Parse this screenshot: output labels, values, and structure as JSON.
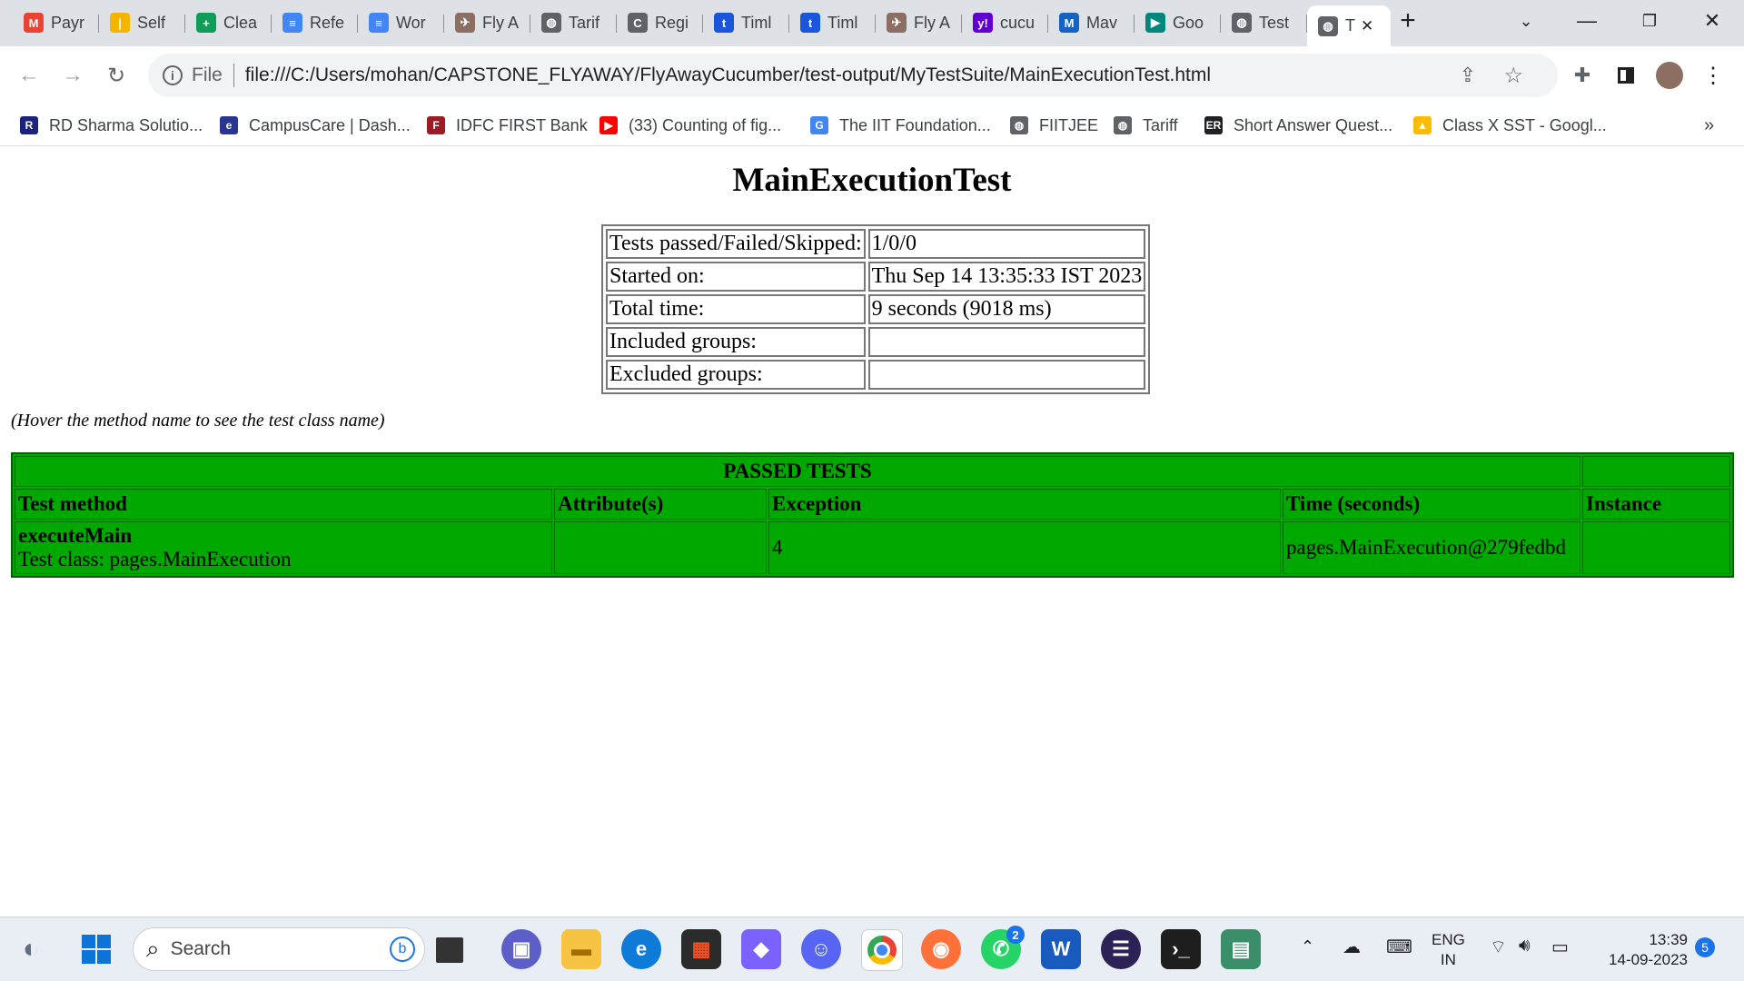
{
  "tabs": [
    {
      "label": "Payr",
      "icon": "gmail-icon",
      "color": "#ea4335",
      "glyph": "M"
    },
    {
      "label": "Self",
      "icon": "analytics-icon",
      "color": "#f4b400",
      "glyph": "|"
    },
    {
      "label": "Clea",
      "icon": "sheets-icon",
      "color": "#0f9d58",
      "glyph": "+"
    },
    {
      "label": "Refe",
      "icon": "docs-icon",
      "color": "#4285f4",
      "glyph": "≡"
    },
    {
      "label": "Wor",
      "icon": "docs-icon",
      "color": "#4285f4",
      "glyph": "≡"
    },
    {
      "label": "Fly A",
      "icon": "image-icon",
      "color": "#8d6e63",
      "glyph": "✈"
    },
    {
      "label": "Tarif",
      "icon": "globe-icon",
      "color": "#5f6368",
      "glyph": "◍"
    },
    {
      "label": "Regi",
      "icon": "c-icon",
      "color": "#5f6368",
      "glyph": "C"
    },
    {
      "label": "Timl",
      "icon": "t-icon",
      "color": "#1a56db",
      "glyph": "t"
    },
    {
      "label": "Timl",
      "icon": "t-icon",
      "color": "#1a56db",
      "glyph": "t"
    },
    {
      "label": "Fly A",
      "icon": "image-icon",
      "color": "#8d6e63",
      "glyph": "✈"
    },
    {
      "label": "cucu",
      "icon": "yahoo-icon",
      "color": "#6001d2",
      "glyph": "y!"
    },
    {
      "label": "Mav",
      "icon": "mvn-icon",
      "color": "#1565c0",
      "glyph": "M"
    },
    {
      "label": "Goo",
      "icon": "meet-icon",
      "color": "#00897b",
      "glyph": "▶"
    },
    {
      "label": "Test",
      "icon": "globe-icon",
      "color": "#5f6368",
      "glyph": "◍"
    },
    {
      "label": "T",
      "icon": "globe-icon",
      "color": "#5f6368",
      "glyph": "◍",
      "active": true
    }
  ],
  "address": {
    "scheme_label": "File",
    "url": "file:///C:/Users/mohan/CAPSTONE_FLYAWAY/FlyAwayCucumber/test-output/MyTestSuite/MainExecutionTest.html"
  },
  "bookmarks": [
    {
      "label": "RD Sharma Solutio...",
      "icon": "rd-sharma-icon",
      "color": "#1a237e",
      "glyph": "R"
    },
    {
      "label": "CampusCare | Dash...",
      "icon": "campuscare-icon",
      "color": "#283593",
      "glyph": "e"
    },
    {
      "label": "IDFC FIRST Bank",
      "icon": "idfc-icon",
      "color": "#9c1c24",
      "glyph": "F"
    },
    {
      "label": "(33) Counting of fig...",
      "icon": "youtube-icon",
      "color": "#ff0000",
      "glyph": "▶"
    },
    {
      "label": "The IIT Foundation...",
      "icon": "google-icon",
      "color": "#4285f4",
      "glyph": "G"
    },
    {
      "label": "FIITJEE",
      "icon": "globe-icon",
      "color": "#5f6368",
      "glyph": "◍"
    },
    {
      "label": "Tariff",
      "icon": "globe-icon",
      "color": "#5f6368",
      "glyph": "◍"
    },
    {
      "label": "Short Answer Quest...",
      "icon": "er-icon",
      "color": "#202124",
      "glyph": "ER"
    },
    {
      "label": "Class X SST - Googl...",
      "icon": "drive-icon",
      "color": "#fbbc04",
      "glyph": "▲"
    }
  ],
  "report": {
    "title": "MainExecutionTest",
    "summary": [
      {
        "label": "Tests passed/Failed/Skipped:",
        "value": "1/0/0"
      },
      {
        "label": "Started on:",
        "value": "Thu Sep 14 13:35:33 IST 2023"
      },
      {
        "label": "Total time:",
        "value": "9 seconds (9018 ms)"
      },
      {
        "label": "Included groups:",
        "value": ""
      },
      {
        "label": "Excluded groups:",
        "value": ""
      }
    ],
    "hint": "(Hover the method name to see the test class name)",
    "passed_table": {
      "caption": "PASSED TESTS",
      "headers": [
        "Test method",
        "Attribute(s)",
        "Exception",
        "Time (seconds)",
        "Instance"
      ],
      "row": {
        "method": "executeMain",
        "class_line": "Test class: pages.MainExecution",
        "attributes": "",
        "exception": "4",
        "time": "pages.MainExecution@279fedbd",
        "instance": ""
      },
      "bg_color": "#00a800"
    }
  },
  "taskbar": {
    "search_placeholder": "Search",
    "whatsapp_badge": "2",
    "lang_top": "ENG",
    "lang_bottom": "IN",
    "time": "13:39",
    "date": "14-09-2023",
    "notification_count": "5"
  }
}
